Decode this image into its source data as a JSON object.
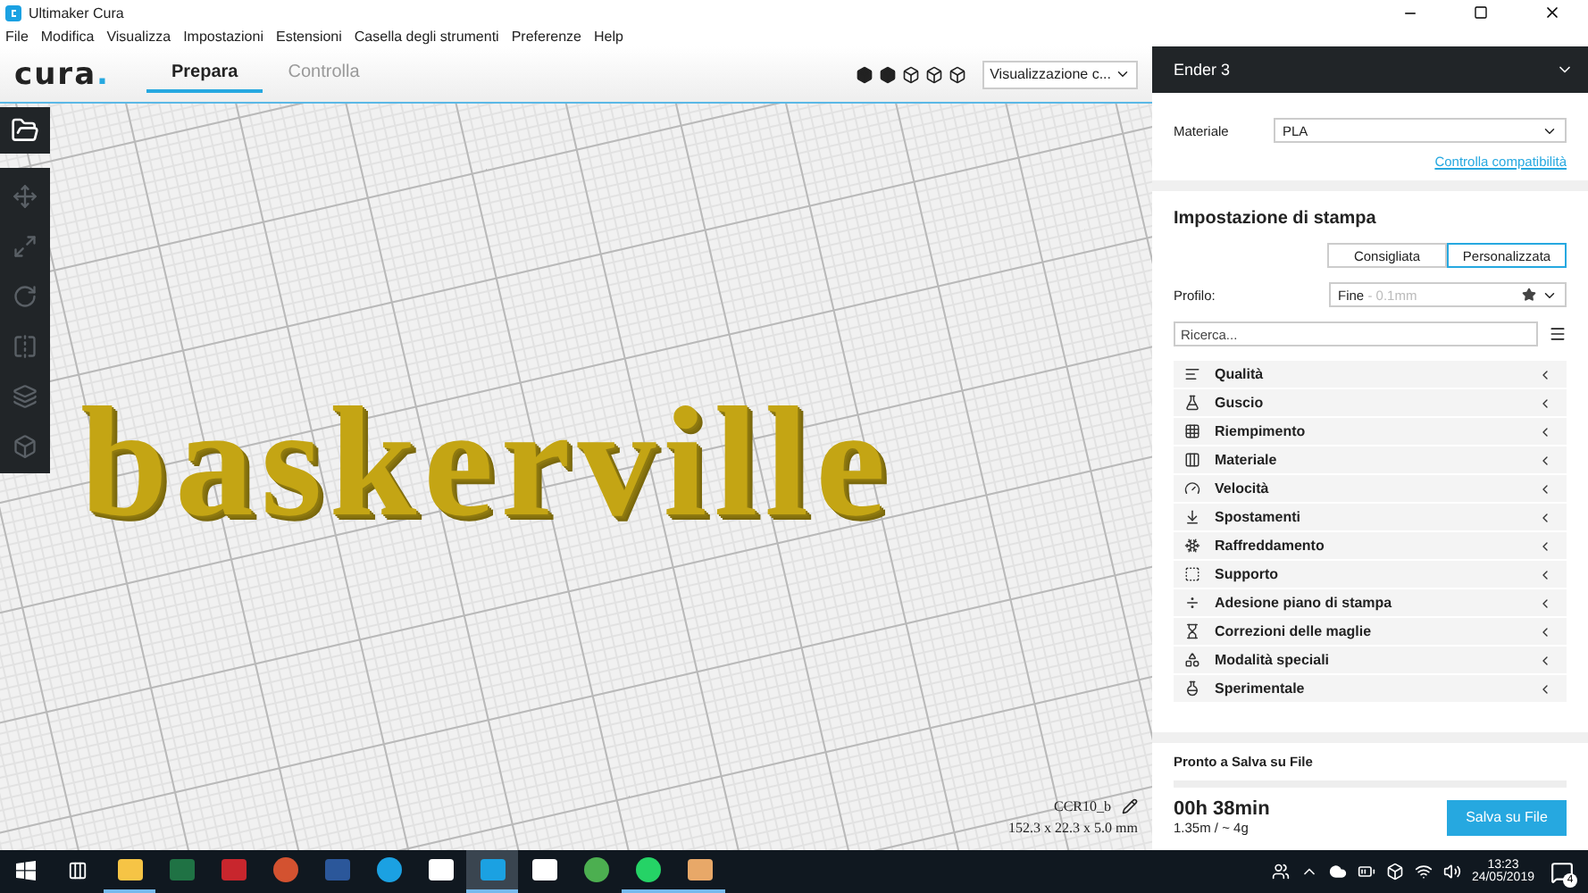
{
  "window": {
    "title": "Ultimaker Cura"
  },
  "menu": [
    "File",
    "Modifica",
    "Visualizza",
    "Impostazioni",
    "Estensioni",
    "Casella degli strumenti",
    "Preferenze",
    "Help"
  ],
  "logo": {
    "text": "cura",
    "dot": "."
  },
  "tabs": [
    {
      "label": "Prepara",
      "selected": true
    },
    {
      "label": "Controlla",
      "selected": false
    }
  ],
  "view_mode": {
    "value": "Visualizzazione c..."
  },
  "model": {
    "text": "baskerville",
    "name": "CCR10_b",
    "dimensions": "152.3 x 22.3 x 5.0 mm"
  },
  "printer": {
    "name": "Ender 3"
  },
  "material": {
    "label": "Materiale",
    "value": "PLA",
    "link": "Controlla compatibilità"
  },
  "print_settings": {
    "title": "Impostazione di stampa",
    "modes": [
      {
        "label": "Consigliata",
        "selected": false
      },
      {
        "label": "Personalizzata",
        "selected": true
      }
    ],
    "profile": {
      "label": "Profilo:",
      "value": "Fine",
      "detail": "- 0.1mm"
    },
    "search": {
      "placeholder": "Ricerca..."
    },
    "categories": [
      "Qualità",
      "Guscio",
      "Riempimento",
      "Materiale",
      "Velocità",
      "Spostamenti",
      "Raffreddamento",
      "Supporto",
      "Adesione piano di stampa",
      "Correzioni delle maglie",
      "Modalità speciali",
      "Sperimentale"
    ]
  },
  "output": {
    "status": "Pronto a Salva su File",
    "time": "00h 38min",
    "usage": "1.35m / ~ 4g",
    "button": "Salva su File"
  },
  "taskbar": {
    "apps": [
      {
        "kind": "folder",
        "running": true,
        "active": false
      },
      {
        "kind": "sheet",
        "running": false,
        "active": false
      },
      {
        "kind": "gift",
        "running": false,
        "active": false
      },
      {
        "kind": "slides",
        "running": false,
        "active": false
      },
      {
        "kind": "doc",
        "running": false,
        "active": false
      },
      {
        "kind": "browser-e",
        "running": false,
        "active": false
      },
      {
        "kind": "mail",
        "running": false,
        "active": false
      },
      {
        "kind": "cura",
        "running": true,
        "active": true
      },
      {
        "kind": "box",
        "running": false,
        "active": false
      },
      {
        "kind": "chrome",
        "running": false,
        "active": false
      },
      {
        "kind": "chat",
        "running": true,
        "active": false
      },
      {
        "kind": "file",
        "running": true,
        "active": false
      }
    ],
    "time": "13:23",
    "date": "24/05/2019",
    "notifications": "4"
  }
}
